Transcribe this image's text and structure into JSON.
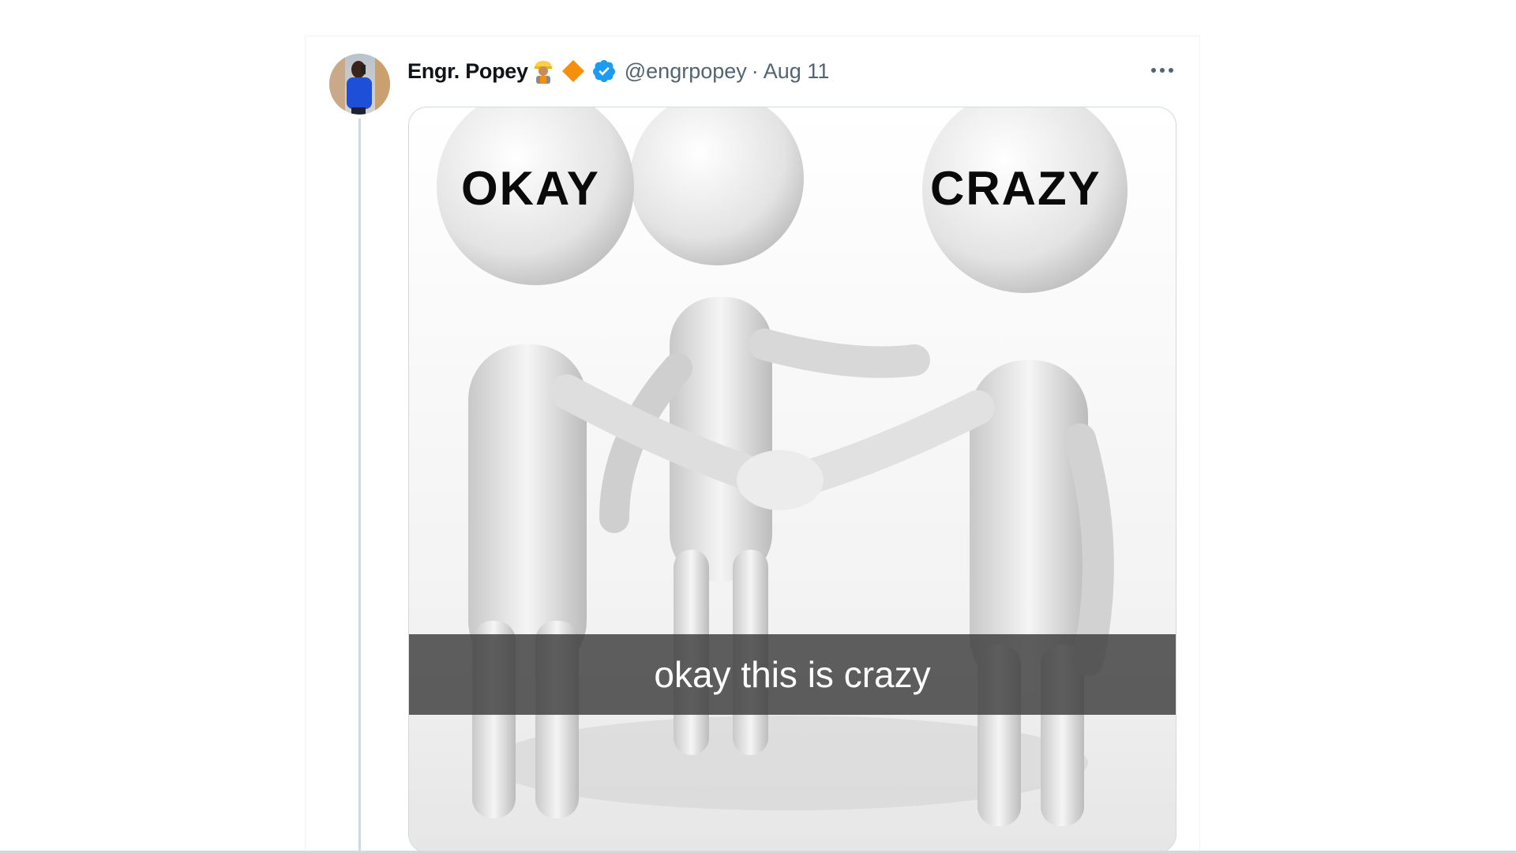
{
  "tweet": {
    "display_name": "Engr. Popey",
    "name_emojis": [
      "construction-worker-emoji",
      "orange-diamond-emoji"
    ],
    "verified": true,
    "handle": "@engrpopey",
    "separator": "·",
    "date": "Aug 11",
    "more_icon": "more-horizontal-icon"
  },
  "media": {
    "meme": {
      "left_head_label": "OKAY",
      "right_head_label": "CRAZY",
      "caption": "okay this is crazy"
    }
  },
  "colors": {
    "verified_blue": "#1d9bf0",
    "secondary_text": "#536471",
    "primary_text": "#0f1419",
    "border": "#cfd9de",
    "diamond_orange": "#f4900c"
  }
}
